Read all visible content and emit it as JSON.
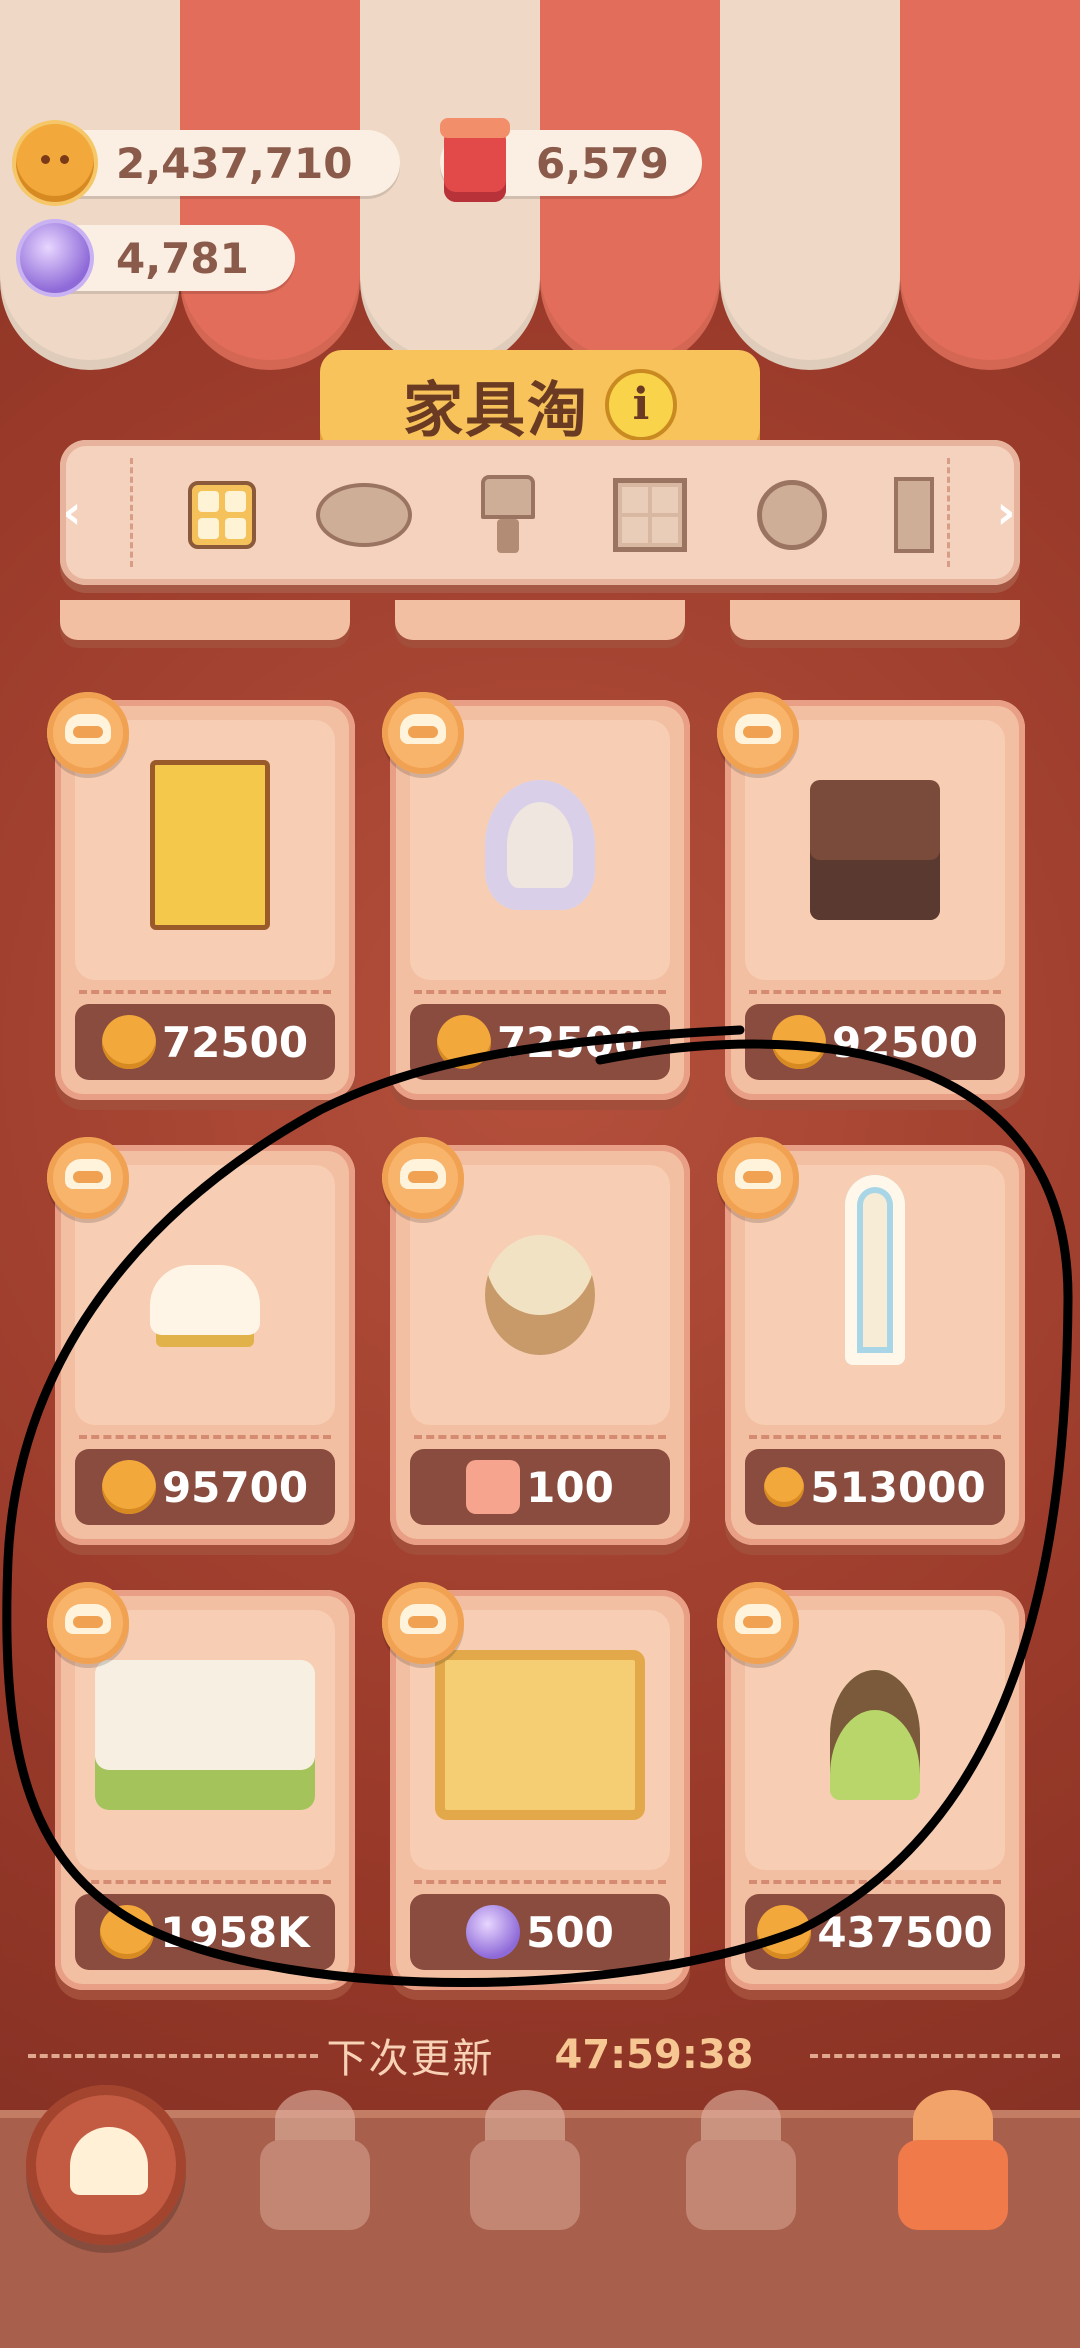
{
  "currencies": {
    "cookies": "2,437,710",
    "jam": "6,579",
    "candy": "4,781"
  },
  "header": {
    "title": "家具淘",
    "info_symbol": "i"
  },
  "categories": [
    {
      "name": "all-furniture",
      "active": true
    },
    {
      "name": "plate"
    },
    {
      "name": "lamp"
    },
    {
      "name": "window"
    },
    {
      "name": "wall-clock"
    },
    {
      "name": "door"
    }
  ],
  "items": [
    {
      "name": "dartboard-banner",
      "price": "72500",
      "currency": "cookie"
    },
    {
      "name": "toilet",
      "price": "72500",
      "currency": "cookie"
    },
    {
      "name": "tv-stand-with-plant",
      "price": "92500",
      "currency": "cookie"
    },
    {
      "name": "cushion-stool",
      "price": "95700",
      "currency": "cookie"
    },
    {
      "name": "teddy-bear-basket",
      "price": "100",
      "currency": "ticket"
    },
    {
      "name": "standing-mirror",
      "price": "513000",
      "currency": "cookie-small"
    },
    {
      "name": "bakery-display-case",
      "price": "1958K",
      "currency": "cookie"
    },
    {
      "name": "bread-cabinet",
      "price": "500",
      "currency": "candy"
    },
    {
      "name": "lace-stool",
      "price": "437500",
      "currency": "cookie"
    }
  ],
  "footer": {
    "refresh_label": "下次更新",
    "refresh_time": "47:59:38"
  },
  "bottom_nav": [
    {
      "name": "back"
    },
    {
      "name": "carousel"
    },
    {
      "name": "costume"
    },
    {
      "name": "house"
    },
    {
      "name": "furniture",
      "active": true
    }
  ],
  "colors": {
    "accent": "#f7c35a",
    "card": "#f3bfa2",
    "price_bar": "#8a4c3e",
    "background": "#9c3c2c"
  }
}
